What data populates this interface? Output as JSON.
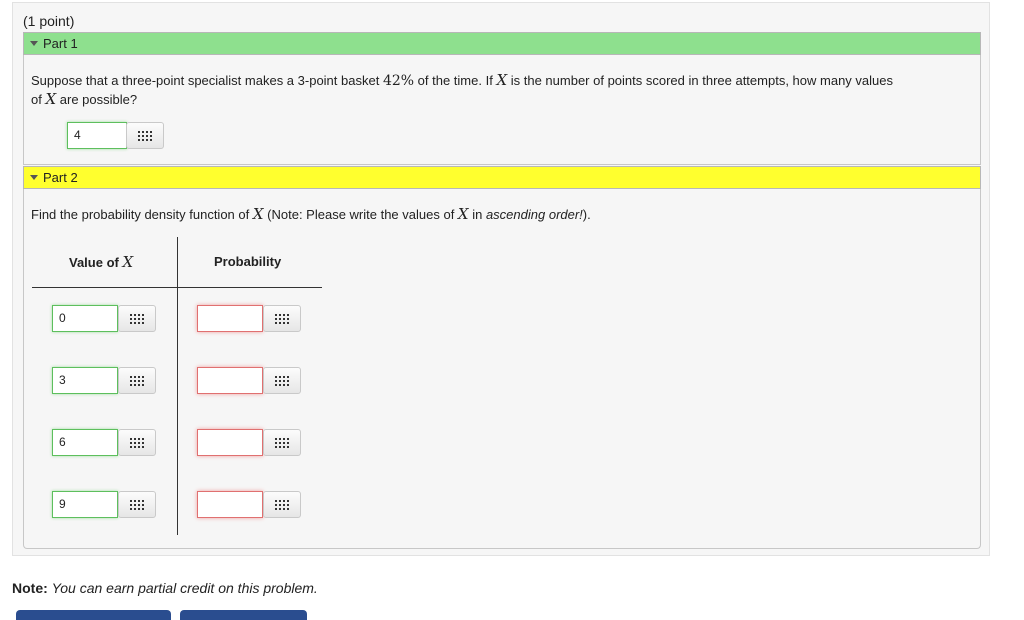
{
  "header": {
    "points": "(1 point)"
  },
  "part1": {
    "title": "Part 1",
    "question_pre": "Suppose that a three-point specialist makes a 3-point basket ",
    "percent": "42%",
    "question_mid": " of the time. If ",
    "var": "X",
    "question_post": " is the number of points scored in three attempts, how many values",
    "question_line2_pre": "of ",
    "question_line2_post": " are possible?",
    "answer": "4"
  },
  "part2": {
    "title": "Part 2",
    "question_pre": "Find the probability density function of ",
    "question_mid": " (Note: Please write the values of ",
    "question_post": " in ",
    "question_em": "ascending order!",
    "question_end": ").",
    "col_value_label": "Value of ",
    "col_prob_label": "Probability",
    "values": [
      "0",
      "3",
      "6",
      "9"
    ],
    "probabilities": [
      "",
      "",
      "",
      ""
    ]
  },
  "note": {
    "label": "Note:",
    "text": "You can earn partial credit on this problem."
  },
  "icons": {
    "mathquill": "grid-keyboard-icon",
    "collapse": "triangle-down-icon"
  },
  "colors": {
    "part1_header": "#8ee08e",
    "part2_header": "#ffff2e",
    "correct_border": "#5dbf5d",
    "incorrect_border": "#e07070"
  }
}
